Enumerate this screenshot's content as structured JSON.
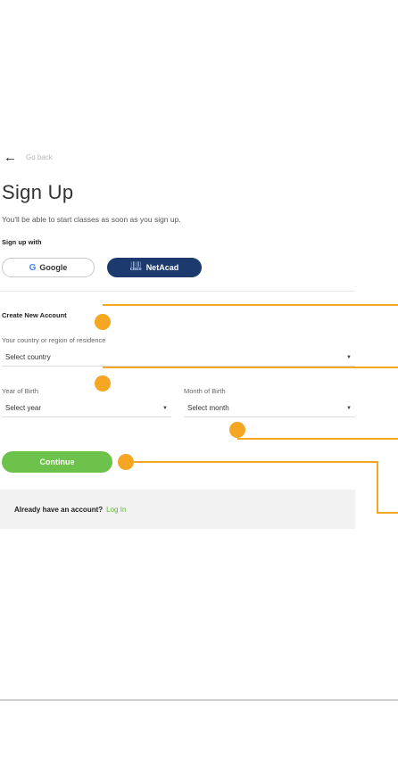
{
  "nav": {
    "back_label": "Go back"
  },
  "page": {
    "title": "Sign Up",
    "subtitle": "You'll be able to start classes as soon as you sign up."
  },
  "signup_with": {
    "label": "Sign up with",
    "google_label": "Google",
    "netacad_label": "NetAcad",
    "cisco_mark": "cisco"
  },
  "form": {
    "section_title": "Create New Account",
    "country": {
      "label": "Your country or region of residence",
      "value": "Select country"
    },
    "year": {
      "label": "Year of Birth",
      "value": "Select year"
    },
    "month": {
      "label": "Month of Birth",
      "value": "Select month"
    },
    "continue_label": "Continue"
  },
  "login": {
    "prompt": "Already have an account?",
    "link": "Log In"
  },
  "colors": {
    "callout": "#f5a623",
    "primary_green": "#6cc24a",
    "netacad_navy": "#1d3a6e"
  },
  "icons": [
    "back-arrow-icon",
    "google-g-icon",
    "cisco-logo-icon",
    "dropdown-caret-icon"
  ]
}
